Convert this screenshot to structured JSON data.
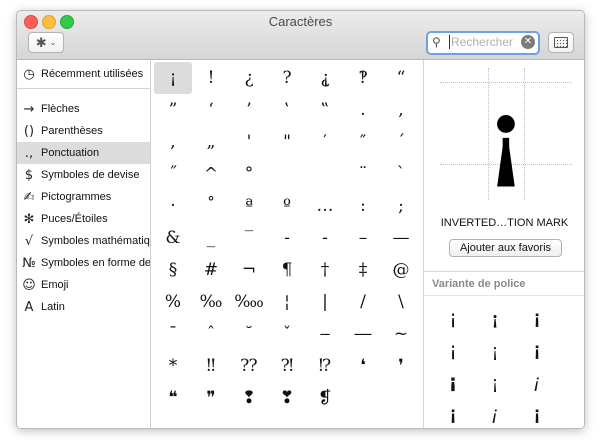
{
  "window": {
    "title": "Caractères"
  },
  "toolbar": {
    "gear_icon": "✱",
    "gear_chevron": "⌄",
    "search_icon": "⚲",
    "search_placeholder": "Rechercher",
    "clear_icon": "✕"
  },
  "sidebar": {
    "items": [
      {
        "icon": "◷",
        "label": "Récemment utilisées"
      },
      {
        "icon": "→",
        "label": "Flèches"
      },
      {
        "icon": "()",
        "label": "Parenthèses"
      },
      {
        "icon": ".,",
        "label": "Ponctuation"
      },
      {
        "icon": "$",
        "label": "Symboles de devise"
      },
      {
        "icon": "✍",
        "label": "Pictogrammes"
      },
      {
        "icon": "✻",
        "label": "Puces/Étoiles"
      },
      {
        "icon": "√",
        "label": "Symboles mathématiques"
      },
      {
        "icon": "№",
        "label": "Symboles en forme de lettre"
      },
      {
        "icon": "☺",
        "label": "Emoji"
      },
      {
        "icon": "A",
        "label": "Latin"
      }
    ]
  },
  "grid": {
    "rows": [
      [
        "¡",
        "!",
        "¿",
        "?",
        "⸘",
        "‽",
        "“"
      ],
      [
        "”",
        "‘",
        "’",
        "‛",
        "‟",
        ".",
        ","
      ],
      [
        ",",
        "„",
        "'",
        "\"",
        "′",
        "″",
        "´"
      ],
      [
        "˝",
        "^",
        "°",
        "",
        "",
        "¨",
        "`"
      ],
      [
        "·",
        "˚",
        "ª",
        "º",
        "…",
        ":",
        ";"
      ],
      [
        "&",
        "_",
        "‾",
        "‐",
        "‑",
        "–",
        "—"
      ],
      [
        "§",
        "#",
        "¬",
        "¶",
        "†",
        "‡",
        "@"
      ],
      [
        "%",
        "‰",
        "‱",
        "¦",
        "|",
        "/",
        "\\"
      ],
      [
        "ˉ",
        "ˆ",
        "˘",
        "ˇ",
        "‒",
        "―",
        "~"
      ],
      [
        "*",
        "‼",
        "⁇",
        "⁈",
        "⁉",
        "❛",
        "❜"
      ],
      [
        "❝",
        "❞",
        "❢",
        "❣",
        "❡",
        "",
        ""
      ]
    ]
  },
  "detail": {
    "preview_glyph": "¡",
    "char_name": "INVERTED…TION MARK",
    "favorites_button": "Ajouter aux favoris",
    "font_variant_heading": "Variante de police",
    "variants": [
      "¡",
      "¡",
      "¡",
      "¡",
      "¡",
      "¡",
      "¡",
      "¡",
      "¡",
      "¡",
      "¡",
      "¡"
    ]
  }
}
